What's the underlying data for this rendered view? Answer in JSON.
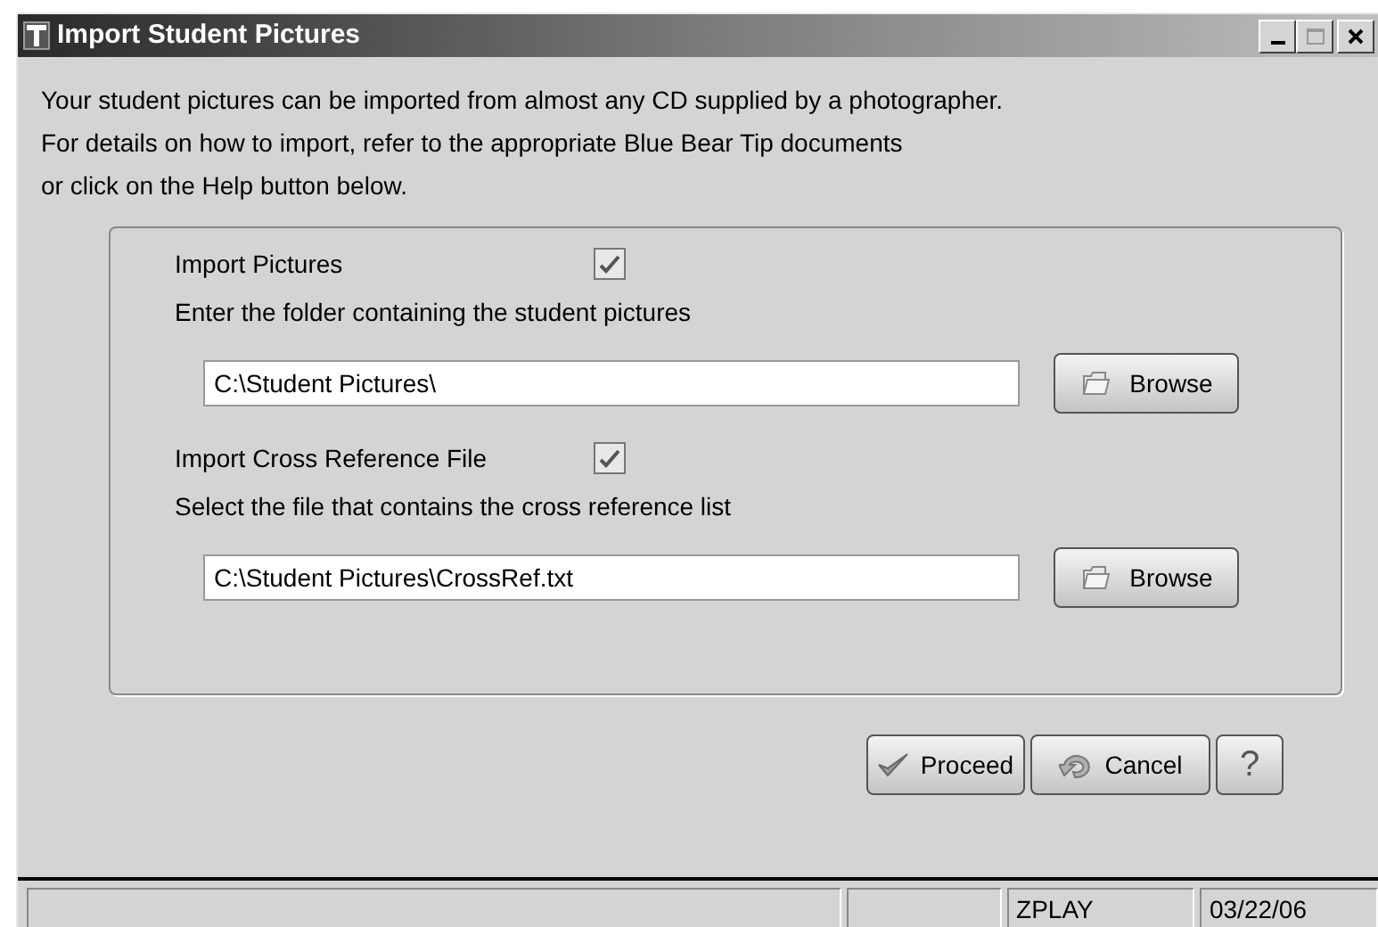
{
  "window": {
    "title": "Import Student Pictures"
  },
  "intro": [
    "Your student pictures can be imported from almost any CD supplied by a photographer.",
    "For details on how to import, refer to the appropriate Blue Bear Tip documents",
    "or click on the Help button below."
  ],
  "sections": [
    {
      "label": "Import Pictures",
      "checked": true,
      "prompt": "Enter the folder containing the student pictures",
      "value": "C:\\Student Pictures\\",
      "button": "Browse"
    },
    {
      "label": "Import Cross Reference File",
      "checked": true,
      "prompt": "Select the file that contains the cross reference list",
      "value": "C:\\Student Pictures\\CrossRef.txt",
      "button": "Browse"
    }
  ],
  "buttons": [
    {
      "kind": "proceed",
      "label": "Proceed"
    },
    {
      "kind": "cancel",
      "label": "Cancel"
    },
    {
      "kind": "help",
      "label": "?"
    }
  ],
  "status_bar": [
    "ZPLAY",
    "03/22/06"
  ]
}
